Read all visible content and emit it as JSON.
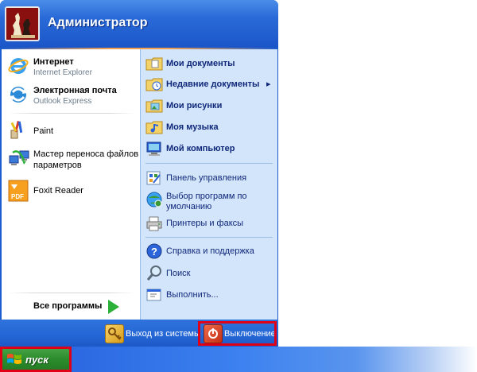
{
  "user": {
    "name": "Администратор"
  },
  "pinned": [
    {
      "title": "Интернет",
      "subtitle": "Internet Explorer",
      "icon": "internet-explorer-icon"
    },
    {
      "title": "Электронная почта",
      "subtitle": "Outlook Express",
      "icon": "outlook-express-icon"
    }
  ],
  "recent": [
    {
      "title": "Paint",
      "icon": "paint-icon"
    },
    {
      "title_line1": "Мастер переноса файлов и",
      "title_line2": "параметров",
      "icon": "transfer-wizard-icon"
    },
    {
      "title": "Foxit Reader",
      "icon": "foxit-reader-icon"
    }
  ],
  "all_programs": {
    "label": "Все программы"
  },
  "places": [
    {
      "label": "Мои документы",
      "icon": "my-documents-icon"
    },
    {
      "label": "Недавние документы",
      "icon": "recent-documents-icon",
      "submenu": "▸"
    },
    {
      "label": "Мои рисунки",
      "icon": "my-pictures-icon"
    },
    {
      "label": "Моя музыка",
      "icon": "my-music-icon"
    },
    {
      "label": "Мой компьютер",
      "icon": "my-computer-icon"
    }
  ],
  "system": [
    {
      "label": "Панель управления",
      "icon": "control-panel-icon"
    },
    {
      "label_line1": "Выбор программ по",
      "label_line2": "умолчанию",
      "icon": "default-programs-icon"
    },
    {
      "label": "Принтеры и факсы",
      "icon": "printers-icon"
    }
  ],
  "help": [
    {
      "label": "Справка и поддержка",
      "icon": "help-icon"
    },
    {
      "label": "Поиск",
      "icon": "search-icon"
    },
    {
      "label": "Выполнить...",
      "icon": "run-icon"
    }
  ],
  "footer": {
    "logoff": "Выход из системы",
    "shutdown": "Выключение"
  },
  "taskbar": {
    "start_label": "пуск"
  },
  "colors": {
    "highlight_frame": "#e00018",
    "menu_blue": "#1b5ccf",
    "start_green": "#2c8c2c"
  }
}
